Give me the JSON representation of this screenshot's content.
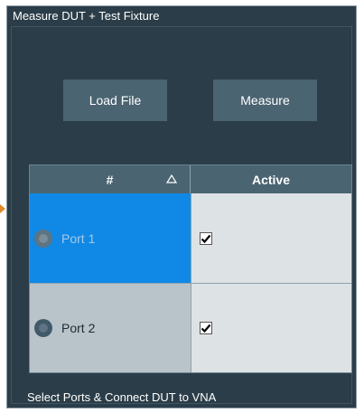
{
  "panel": {
    "title": "Measure DUT + Test Fixture"
  },
  "buttons": {
    "load_file": "Load File",
    "measure": "Measure"
  },
  "table": {
    "columns": [
      "#",
      "Active"
    ],
    "rows": [
      {
        "port": "Port 1",
        "active": true,
        "selected": true
      },
      {
        "port": "Port 2",
        "active": true,
        "selected": false
      }
    ]
  },
  "status": "Select Ports & Connect DUT to VNA",
  "colors": {
    "panel_bg": "#2b3d48",
    "button_bg": "#4b6472",
    "selected_row": "#1089e6",
    "edge_marker": "#e08a2a"
  },
  "icons": {
    "sort": "sort-ascending-triangle-icon",
    "checkbox": "checkmark-icon",
    "port": "port-led-icon"
  }
}
